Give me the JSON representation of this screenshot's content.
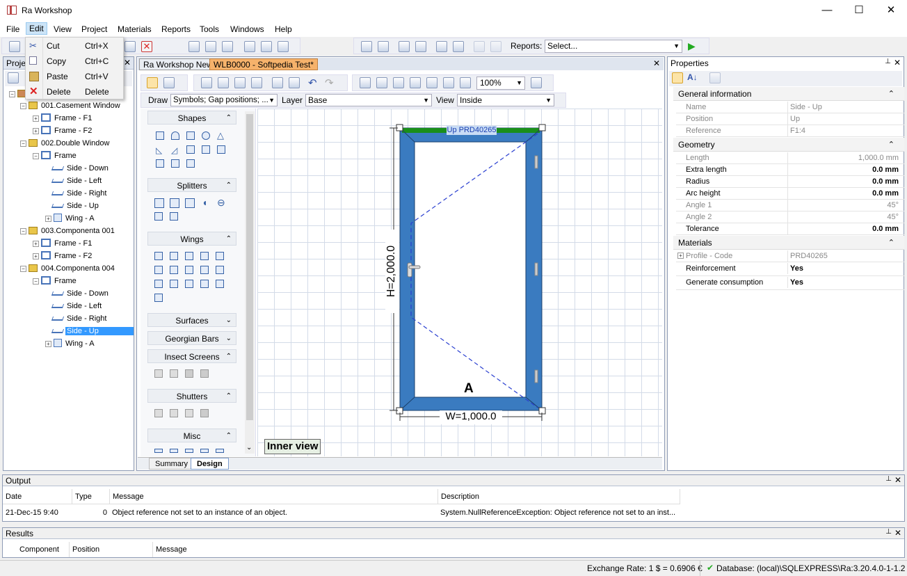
{
  "window": {
    "title": "Ra Workshop",
    "minimize": "—",
    "maximize": "☐",
    "close": "✕"
  },
  "menu": [
    "File",
    "Edit",
    "View",
    "Project",
    "Materials",
    "Reports",
    "Tools",
    "Windows",
    "Help"
  ],
  "context_menu": [
    {
      "label": "Cut",
      "shortcut": "Ctrl+X"
    },
    {
      "label": "Copy",
      "shortcut": "Ctrl+C"
    },
    {
      "label": "Paste",
      "shortcut": "Ctrl+V"
    },
    {
      "label": "Delete",
      "shortcut": "Delete"
    }
  ],
  "toolbar": {
    "reports_label": "Reports:",
    "reports_select": "Select..."
  },
  "project_panel": {
    "title": "Projec"
  },
  "tree": [
    {
      "label": "001.Casement Window"
    },
    {
      "label": "Frame - F1"
    },
    {
      "label": "Frame - F2"
    },
    {
      "label": "002.Double Window"
    },
    {
      "label": "Frame"
    },
    {
      "label": "Side - Down"
    },
    {
      "label": "Side - Left"
    },
    {
      "label": "Side - Right"
    },
    {
      "label": "Side - Up"
    },
    {
      "label": "Wing - A"
    },
    {
      "label": "003.Componenta 001"
    },
    {
      "label": "Frame - F1"
    },
    {
      "label": "Frame - F2"
    },
    {
      "label": "004.Componenta 004"
    },
    {
      "label": "Frame"
    },
    {
      "label": "Side - Down"
    },
    {
      "label": "Side - Left"
    },
    {
      "label": "Side - Right"
    },
    {
      "label": "Side - Up"
    },
    {
      "label": "Wing - A"
    }
  ],
  "doc_tabs": [
    "Ra Workshop News",
    "WLB0000 - Softpedia Test*"
  ],
  "design_toolbar": {
    "zoom": "100%",
    "draw_label": "Draw",
    "draw_value": "Symbols; Gap positions; ...",
    "layer_label": "Layer",
    "layer_value": "Base",
    "view_label": "View",
    "view_value": "Inside"
  },
  "palette": [
    "Shapes",
    "Splitters",
    "Wings",
    "Surfaces",
    "Georgian Bars",
    "Insect Screens",
    "Shutters",
    "Misc"
  ],
  "drawing": {
    "top_profile": "Up PRD40265",
    "height_dim": "H=2,000.0",
    "width_dim": "W=1,000.0",
    "wing": "A",
    "inner_view": "Inner view"
  },
  "bottom_tabs": [
    "Summary",
    "Design"
  ],
  "properties": {
    "title": "Properties",
    "sections": {
      "general": "General information",
      "geometry": "Geometry",
      "materials": "Materials"
    },
    "general": [
      {
        "name": "Name",
        "value": "Side - Up"
      },
      {
        "name": "Position",
        "value": "Up"
      },
      {
        "name": "Reference",
        "value": "F1:4"
      }
    ],
    "geometry": [
      {
        "name": "Length",
        "value": "1,000.0 mm"
      },
      {
        "name": "Extra length",
        "value": "0.0 mm"
      },
      {
        "name": "Radius",
        "value": "0.0 mm"
      },
      {
        "name": "Arc height",
        "value": "0.0 mm"
      },
      {
        "name": "Angle 1",
        "value": "45°"
      },
      {
        "name": "Angle 2",
        "value": "45°"
      },
      {
        "name": "Tolerance",
        "value": "0.0 mm"
      }
    ],
    "materials": [
      {
        "name": "Profile - Code",
        "value": "PRD40265"
      },
      {
        "name": "Reinforcement",
        "value": "Yes"
      },
      {
        "name": "Generate consumption",
        "value": "Yes"
      }
    ]
  },
  "output": {
    "title": "Output",
    "columns": [
      "Date",
      "Type",
      "Message",
      "Description"
    ],
    "row": {
      "date": "21-Dec-15 9:40",
      "type": "0",
      "message": "Object reference not set to an instance of an object.",
      "description": "System.NullReferenceException: Object reference not set to an inst..."
    }
  },
  "results": {
    "title": "Results",
    "columns": [
      "Component",
      "Position",
      "Message"
    ]
  },
  "status": {
    "exchange": "Exchange Rate: 1 $ = 0.6906 €",
    "database": "Database: (local)\\SQLEXPRESS\\Ra:3.20.4.0-1-1.2"
  }
}
